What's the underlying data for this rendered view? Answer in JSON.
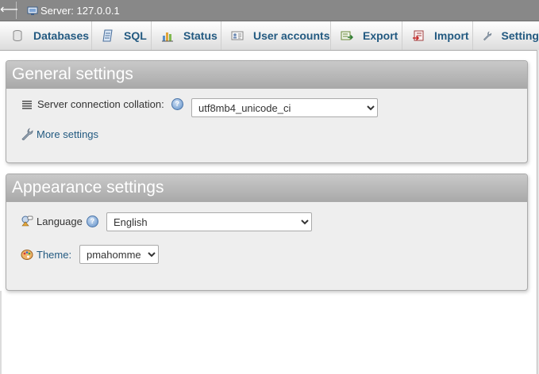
{
  "topbar": {
    "back_icon": "left-arrow-icon",
    "server_icon": "server-icon",
    "label": "Server: 127.0.0.1"
  },
  "tabs": [
    {
      "label": "Databases",
      "icon": "database-icon"
    },
    {
      "label": "SQL",
      "icon": "sql-icon"
    },
    {
      "label": "Status",
      "icon": "status-chart-icon"
    },
    {
      "label": "User accounts",
      "icon": "user-accounts-icon"
    },
    {
      "label": "Export",
      "icon": "export-icon"
    },
    {
      "label": "Import",
      "icon": "import-icon"
    },
    {
      "label": "Setting",
      "icon": "wrench-icon"
    }
  ],
  "general": {
    "title": "General settings",
    "collation_label": "Server connection collation:",
    "collation_value": "utf8mb4_unicode_ci",
    "more_settings": "More settings"
  },
  "appearance": {
    "title": "Appearance settings",
    "language_label": "Language",
    "language_value": "English",
    "theme_label": "Theme:",
    "theme_value": "pmahomme"
  },
  "colors": {
    "link": "#235a81",
    "panel_bg": "#eeeeee",
    "topbar_bg": "#888888"
  }
}
